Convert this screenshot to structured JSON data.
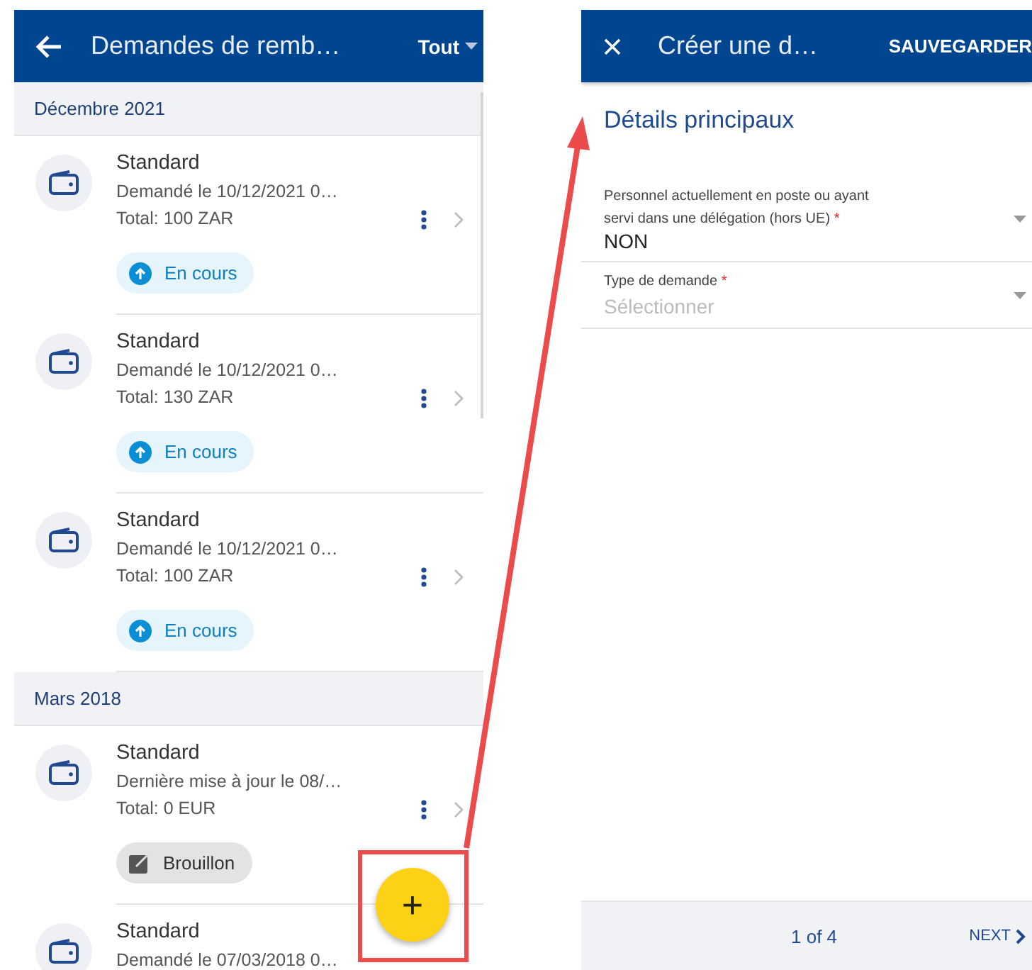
{
  "list_screen": {
    "title": "Demandes de remb…",
    "filter": "Tout",
    "sections": [
      {
        "heading": "Décembre 2021",
        "items": [
          {
            "title": "Standard",
            "subtitle": "Demandé le 10/12/2021 0…",
            "total": "Total: 100 ZAR",
            "status": {
              "kind": "in_progress",
              "label": "En cours"
            }
          },
          {
            "title": "Standard",
            "subtitle": "Demandé le 10/12/2021 0…",
            "total": "Total: 130 ZAR",
            "status": {
              "kind": "in_progress",
              "label": "En cours"
            }
          },
          {
            "title": "Standard",
            "subtitle": "Demandé le 10/12/2021 0…",
            "total": "Total: 100 ZAR",
            "status": {
              "kind": "in_progress",
              "label": "En cours"
            }
          }
        ]
      },
      {
        "heading": "Mars 2018",
        "items": [
          {
            "title": "Standard",
            "subtitle": "Dernière mise à jour le 08/…",
            "total": "Total: 0 EUR",
            "status": {
              "kind": "draft",
              "label": "Brouillon"
            }
          },
          {
            "title": "Standard",
            "subtitle": "Demandé le 07/03/2018 0…"
          }
        ]
      }
    ],
    "fab": "+"
  },
  "form_screen": {
    "title": "Créer une d…",
    "save": "SAUVEGARDER",
    "section_title": "Détails principaux",
    "fields": [
      {
        "label": "Personnel actuellement en poste ou ayant servi dans une délégation (hors UE)",
        "required_mark": "*",
        "value": "NON"
      },
      {
        "label": "Type de demande",
        "required_mark": "*",
        "placeholder": "Sélectionner"
      }
    ],
    "pager": "1 of 4",
    "next": "NEXT"
  }
}
